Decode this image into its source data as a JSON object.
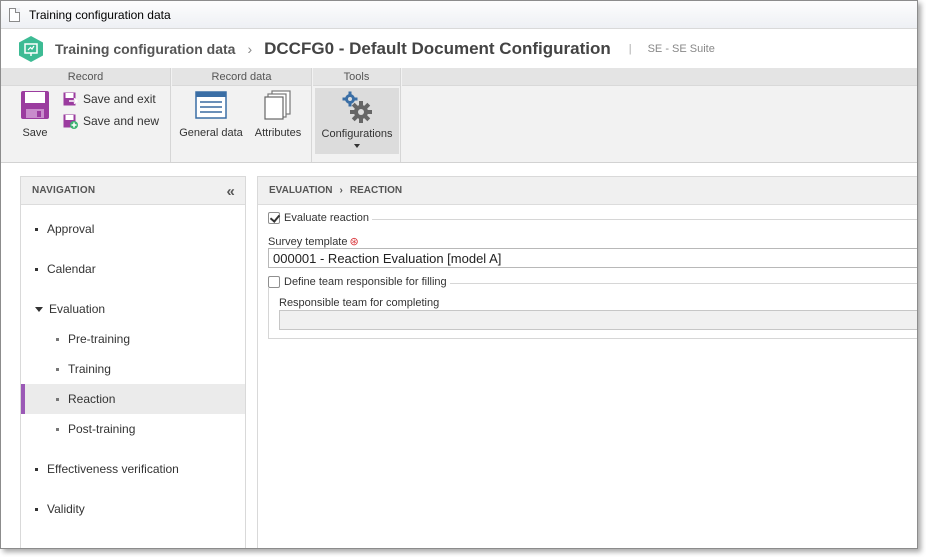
{
  "window": {
    "title": "Training configuration data"
  },
  "header": {
    "parent": "Training configuration data",
    "separator": "›",
    "current": "DCCFG0 - Default Document Configuration",
    "divider": "|",
    "suite": "SE - SE Suite"
  },
  "ribbon": {
    "groups": {
      "record": "Record",
      "record_data": "Record data",
      "tools": "Tools"
    },
    "buttons": {
      "save": "Save",
      "save_and_exit": "Save and exit",
      "save_and_new": "Save and new",
      "general_data": "General data",
      "attributes": "Attributes",
      "configurations": "Configurations"
    }
  },
  "navigation": {
    "title": "NAVIGATION",
    "items": [
      {
        "label": "Approval"
      },
      {
        "label": "Calendar"
      },
      {
        "label": "Evaluation",
        "children": [
          {
            "label": "Pre-training"
          },
          {
            "label": "Training"
          },
          {
            "label": "Reaction",
            "active": true
          },
          {
            "label": "Post-training"
          }
        ]
      },
      {
        "label": "Effectiveness verification"
      },
      {
        "label": "Validity"
      }
    ]
  },
  "content": {
    "breadcrumb": {
      "section": "EVALUATION",
      "sep": "›",
      "page": "REACTION"
    },
    "evaluate_reaction": {
      "label": "Evaluate reaction",
      "checked": true
    },
    "survey_template": {
      "label": "Survey template",
      "required_mark": "⊛",
      "value": "000001 - Reaction Evaluation [model A]"
    },
    "define_team": {
      "label": "Define team responsible for filling",
      "checked": false
    },
    "responsible_team": {
      "label": "Responsible team for completing",
      "value": ""
    }
  },
  "colors": {
    "accent": "#9b59b6",
    "logo": "#3dbb94",
    "required": "#d9343a"
  }
}
